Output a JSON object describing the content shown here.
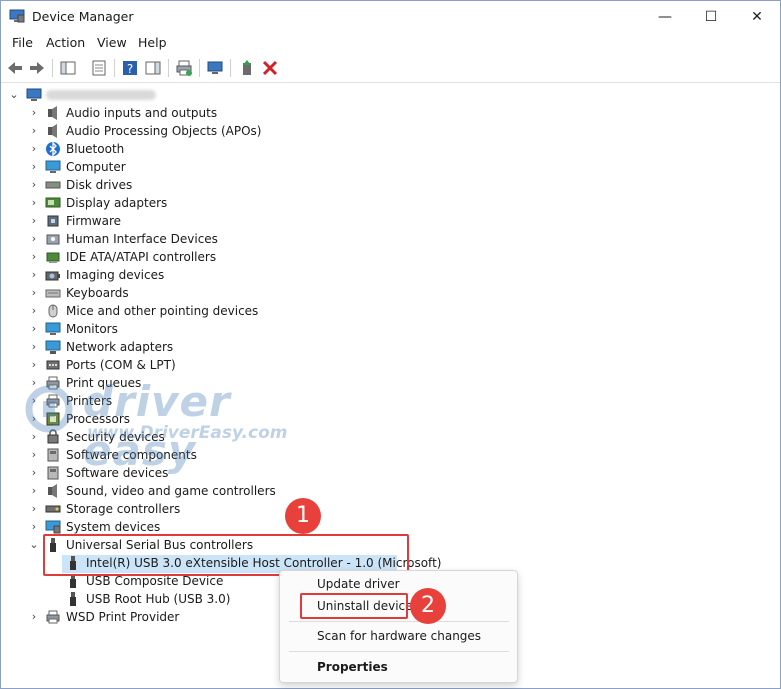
{
  "window": {
    "title": "Device Manager"
  },
  "window_controls": {
    "minimize": "—",
    "maximize": "☐",
    "close": "✕"
  },
  "menu": [
    "File",
    "Action",
    "View",
    "Help"
  ],
  "tree": {
    "categories": [
      {
        "label": "Audio inputs and outputs",
        "icon": "speaker-icon"
      },
      {
        "label": "Audio Processing Objects (APOs)",
        "icon": "speaker-icon"
      },
      {
        "label": "Bluetooth",
        "icon": "bluetooth-icon"
      },
      {
        "label": "Computer",
        "icon": "monitor-icon"
      },
      {
        "label": "Disk drives",
        "icon": "disk-icon"
      },
      {
        "label": "Display adapters",
        "icon": "display-adapter-icon"
      },
      {
        "label": "Firmware",
        "icon": "chip-icon"
      },
      {
        "label": "Human Interface Devices",
        "icon": "hid-icon"
      },
      {
        "label": "IDE ATA/ATAPI controllers",
        "icon": "ide-icon"
      },
      {
        "label": "Imaging devices",
        "icon": "camera-icon"
      },
      {
        "label": "Keyboards",
        "icon": "keyboard-icon"
      },
      {
        "label": "Mice and other pointing devices",
        "icon": "mouse-icon"
      },
      {
        "label": "Monitors",
        "icon": "monitor-icon"
      },
      {
        "label": "Network adapters",
        "icon": "network-icon"
      },
      {
        "label": "Ports (COM & LPT)",
        "icon": "port-icon"
      },
      {
        "label": "Print queues",
        "icon": "printer-icon"
      },
      {
        "label": "Printers",
        "icon": "printer-icon"
      },
      {
        "label": "Processors",
        "icon": "cpu-icon"
      },
      {
        "label": "Security devices",
        "icon": "security-icon"
      },
      {
        "label": "Software components",
        "icon": "software-icon"
      },
      {
        "label": "Software devices",
        "icon": "software-icon"
      },
      {
        "label": "Sound, video and game controllers",
        "icon": "speaker-icon"
      },
      {
        "label": "Storage controllers",
        "icon": "storage-icon"
      },
      {
        "label": "System devices",
        "icon": "system-icon"
      }
    ],
    "usb_category": "Universal Serial Bus controllers",
    "usb_children": [
      "Intel(R) USB 3.0 eXtensible Host Controller - 1.0 (Microsoft)",
      "USB Composite Device",
      "USB Root Hub (USB 3.0)"
    ],
    "last_category": "WSD Print Provider"
  },
  "context_menu": {
    "update": "Update driver",
    "uninstall": "Uninstall device",
    "scan": "Scan for hardware changes",
    "properties": "Properties"
  },
  "badges": {
    "step1": "1",
    "step2": "2"
  },
  "watermark": {
    "brand": "driver easy",
    "url": "www.DriverEasy.com"
  },
  "colors": {
    "highlight": "#e03b3b",
    "selection": "#cce4f7",
    "badge": "#e8413b"
  }
}
